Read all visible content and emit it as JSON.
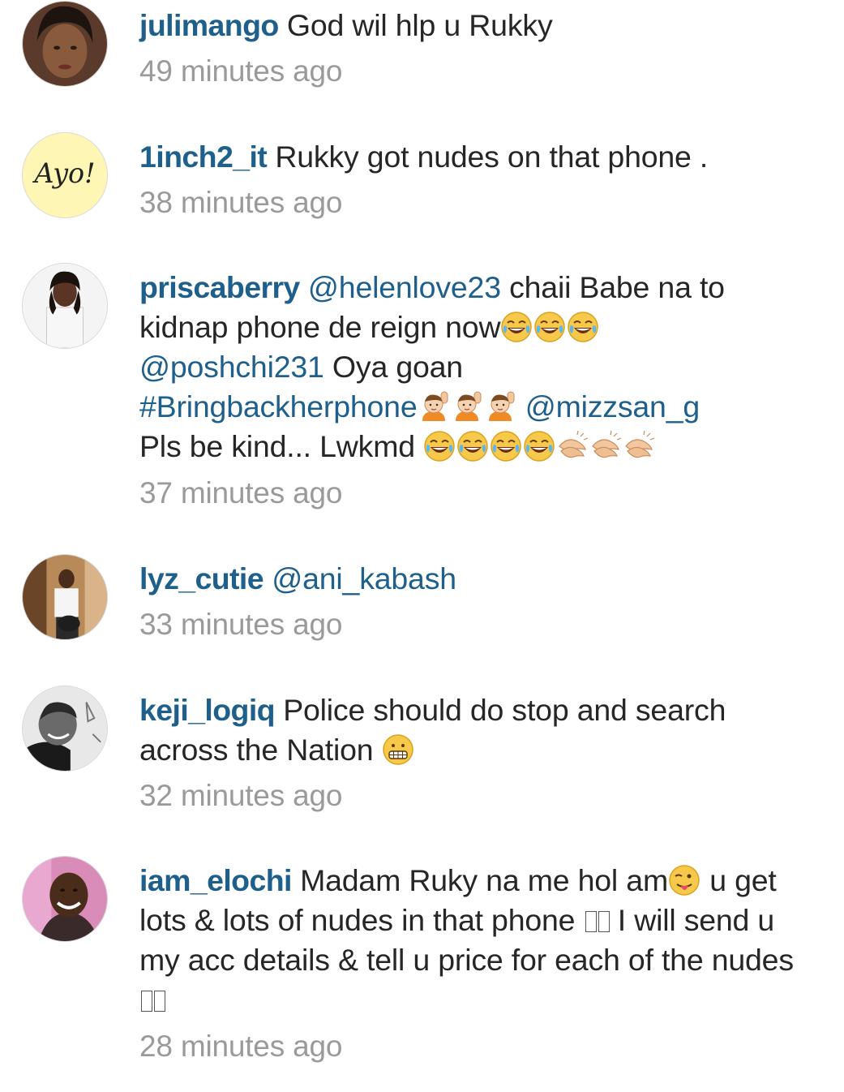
{
  "comments": [
    {
      "username": "julimango",
      "text": "God wil hlp u Rukky",
      "time": "49 minutes ago"
    },
    {
      "username": "1inch2_it",
      "text": "Rukky got nudes on that phone .",
      "time": "38 minutes ago",
      "avatar_text": "Ayo!"
    },
    {
      "username": "priscaberry",
      "mention1": "@helenlove23",
      "text1": "chaii Babe na to kidnap phone de reign now",
      "mention2": "@poshchi231",
      "text2": "Oya goan",
      "hashtag": "#Bringbackherphone",
      "mention3": "@mizzsan_g",
      "text3": "Pls be kind... Lwkmd",
      "time": "37 minutes ago"
    },
    {
      "username": "lyz_cutie",
      "mention1": "@ani_kabash",
      "time": "33 minutes ago"
    },
    {
      "username": "keji_logiq",
      "text": "Police should do stop and search across the Nation",
      "time": "32 minutes ago"
    },
    {
      "username": "iam_elochi",
      "text1": "Madam Ruky na me hol am",
      "text2": "u get lots & lots of nudes in that phone",
      "text3": "I will send u my acc details & tell u price for each of the nudes",
      "time": "28 minutes ago"
    }
  ],
  "icons": {
    "laugh": "face-with-tears-of-joy-icon",
    "raise_hand": "person-raising-hand-icon",
    "clap": "clapping-hands-icon",
    "grimace": "grimacing-face-icon",
    "wink": "winking-tongue-face-icon"
  }
}
